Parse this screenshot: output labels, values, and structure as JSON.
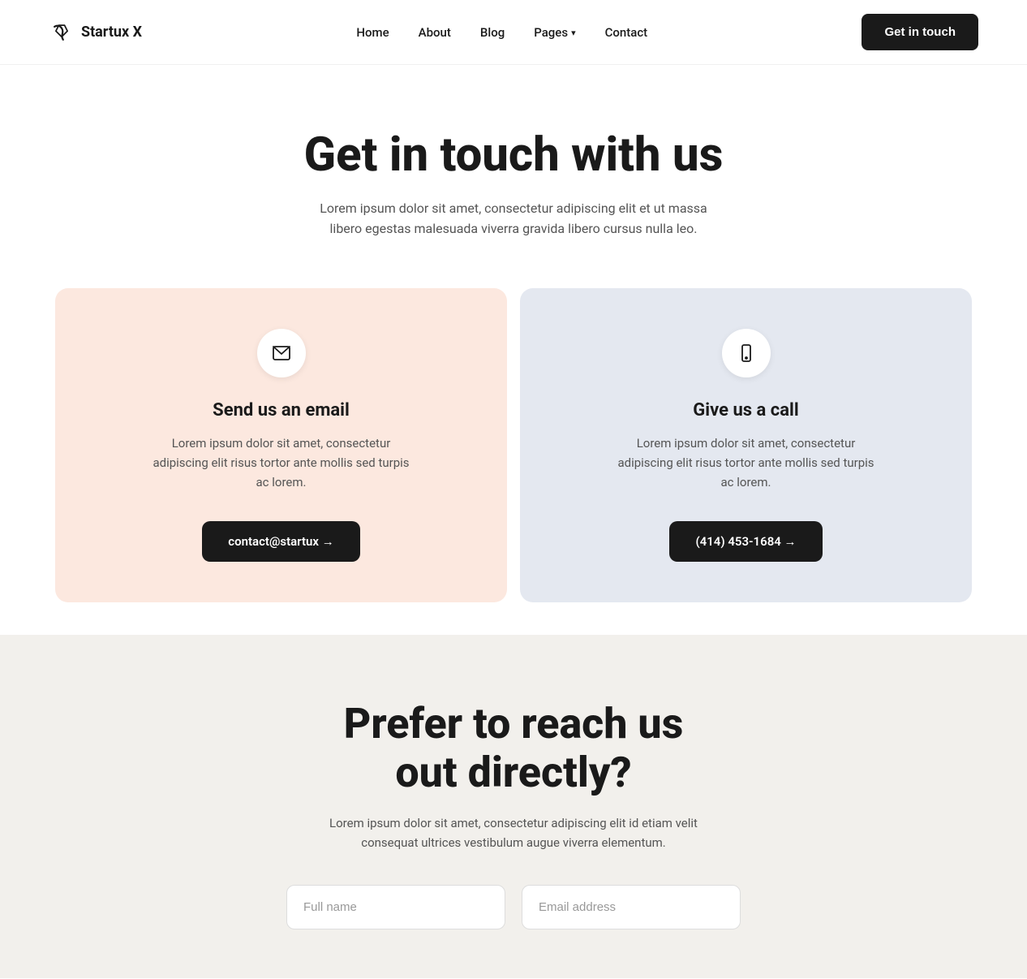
{
  "navbar": {
    "logo_text": "Startux X",
    "links": [
      {
        "label": "Home",
        "id": "home"
      },
      {
        "label": "About",
        "id": "about"
      },
      {
        "label": "Blog",
        "id": "blog"
      },
      {
        "label": "Pages",
        "id": "pages"
      },
      {
        "label": "Contact",
        "id": "contact"
      }
    ],
    "cta_label": "Get in touch"
  },
  "hero": {
    "title": "Get in touch with us",
    "subtitle": "Lorem ipsum dolor sit amet, consectetur adipiscing elit et ut massa libero egestas malesuada viverra gravida libero cursus nulla leo."
  },
  "cards": [
    {
      "id": "email-card",
      "icon": "email",
      "title": "Send us an email",
      "description": "Lorem ipsum dolor sit amet, consectetur adipiscing elit risus tortor ante mollis sed turpis ac lorem.",
      "cta_label": "contact@startux →",
      "bg": "email"
    },
    {
      "id": "phone-card",
      "icon": "phone",
      "title": "Give us a call",
      "description": "Lorem ipsum dolor sit amet, consectetur adipiscing elit risus tortor ante mollis sed turpis ac lorem.",
      "cta_label": "(414) 453-1684 →",
      "bg": "phone"
    }
  ],
  "bottom": {
    "title": "Prefer to reach us out directly?",
    "subtitle": "Lorem ipsum dolor sit amet, consectetur adipiscing elit id etiam velit consequat ultrices vestibulum augue viverra elementum.",
    "form": {
      "name_placeholder": "Full name",
      "email_placeholder": "Email address"
    }
  }
}
